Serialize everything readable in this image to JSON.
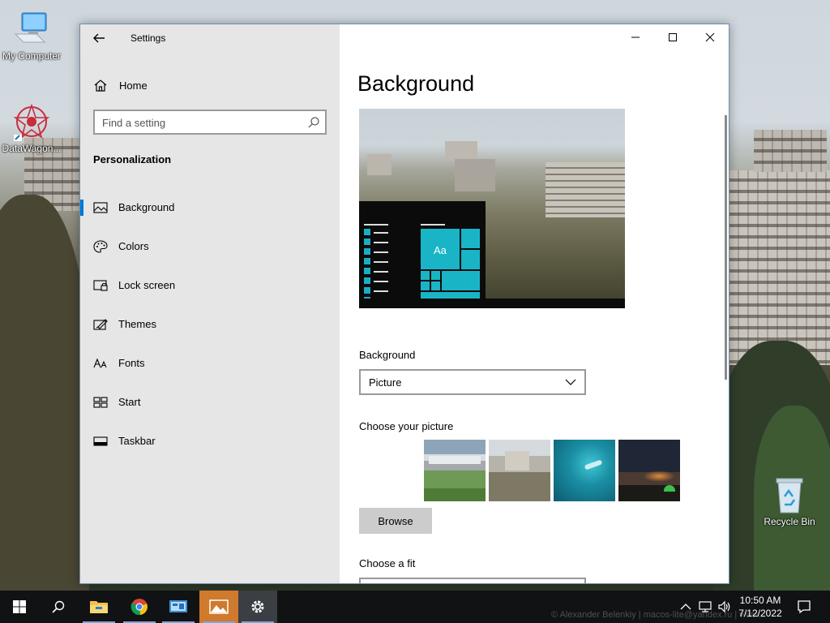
{
  "desktop": {
    "icons": [
      {
        "label": "My Computer",
        "icon": "computer-icon"
      },
      {
        "label": "DataWagon...",
        "icon": "datawagon-icon"
      },
      {
        "label": "Recycle Bin",
        "icon": "recycle-bin-icon"
      }
    ],
    "watermark": "© Alexander Belenkiy | macos-lite@yandex.ru | www..."
  },
  "window": {
    "title": "Settings",
    "controls": {
      "minimize": "minimize-icon",
      "maximize": "maximize-icon",
      "close": "close-icon"
    }
  },
  "sidebar": {
    "home": "Home",
    "search_placeholder": "Find a setting",
    "section": "Personalization",
    "items": [
      {
        "label": "Background",
        "icon": "picture-icon",
        "active": true
      },
      {
        "label": "Colors",
        "icon": "palette-icon"
      },
      {
        "label": "Lock screen",
        "icon": "lock-screen-icon"
      },
      {
        "label": "Themes",
        "icon": "themes-icon"
      },
      {
        "label": "Fonts",
        "icon": "fonts-icon"
      },
      {
        "label": "Start",
        "icon": "start-icon"
      },
      {
        "label": "Taskbar",
        "icon": "taskbar-icon"
      }
    ]
  },
  "main": {
    "heading": "Background",
    "preview_tile_text": "Aa",
    "background_label": "Background",
    "background_value": "Picture",
    "choose_picture_label": "Choose your picture",
    "browse_label": "Browse",
    "choose_fit_label": "Choose a fit"
  },
  "taskbar": {
    "time": "10:50 AM",
    "date": "7/12/2022",
    "apps": [
      "start-icon",
      "search-icon",
      "file-explorer-icon",
      "chrome-icon",
      "control-panel-icon",
      "photos-icon",
      "settings-gear-icon"
    ]
  },
  "colors": {
    "accent": "#0078d7",
    "tile": "#19b5c6",
    "photos_active": "#cf7a2c"
  }
}
